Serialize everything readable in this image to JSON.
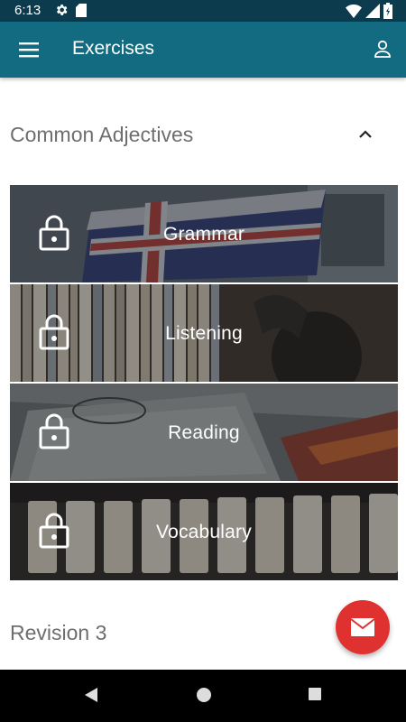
{
  "status_bar": {
    "time": "6:13",
    "icons": [
      "settings-icon",
      "sd-card-icon",
      "wifi-icon",
      "signal-icon",
      "battery-icon"
    ]
  },
  "app_bar": {
    "title": "Exercises",
    "left_icon": "menu-icon",
    "right_icon": "profile-icon",
    "color": "#136b81"
  },
  "sections": [
    {
      "title": "Common Adjectives",
      "expanded": true,
      "exercises": [
        {
          "label": "Grammar",
          "locked": true,
          "icon": "lock-icon"
        },
        {
          "label": "Listening",
          "locked": true,
          "icon": "lock-icon"
        },
        {
          "label": "Reading",
          "locked": true,
          "icon": "lock-icon"
        },
        {
          "label": "Vocabulary",
          "locked": true,
          "icon": "lock-icon"
        }
      ]
    },
    {
      "title": "Revision 3"
    }
  ],
  "fab": {
    "icon": "mail-icon",
    "color": "#e03131"
  },
  "nav_bar": {
    "icons": [
      "back-icon",
      "home-icon",
      "recent-apps-icon"
    ]
  }
}
